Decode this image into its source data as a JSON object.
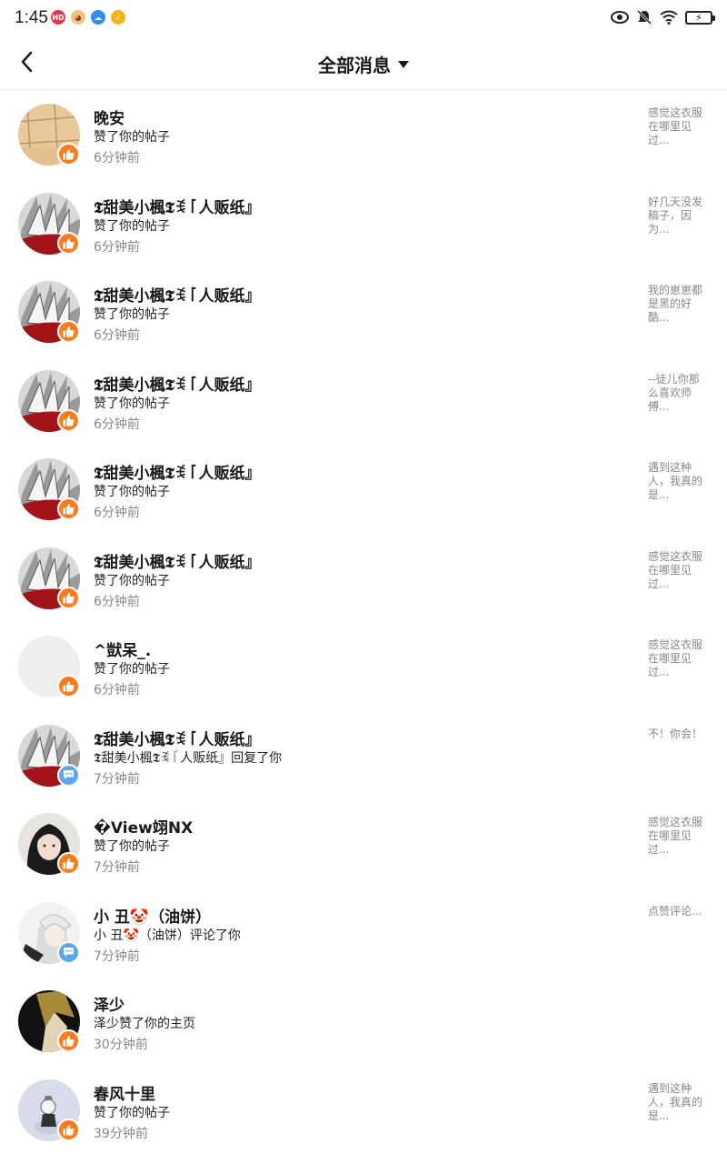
{
  "status_bar": {
    "time": "1:45",
    "app_icons": [
      "hdr-badge-icon",
      "monkey-app-icon",
      "cloud-app-icon",
      "shield-app-icon"
    ],
    "right_icons": [
      "eye-icon",
      "mute-bell-icon",
      "wifi-icon",
      "battery-charging-icon"
    ]
  },
  "header": {
    "title": "全部消息",
    "back_icon": "chevron-left-icon",
    "dropdown_icon": "caret-down-icon"
  },
  "colors": {
    "like_badge": "#ff7a1a",
    "comment_badge": "#5aa6f0",
    "secondary_text": "#888888"
  },
  "messages": [
    {
      "name": "晚安",
      "action": "赞了你的帖子",
      "time": "6分钟前",
      "preview": "感觉这衣服在哪里见过...",
      "badge": "like",
      "avatar": "paper-avatar"
    },
    {
      "name": "𝕿甜美小楓𝕿ꉂ『人贩纸』",
      "action": "赞了你的帖子",
      "time": "6分钟前",
      "preview": "好几天没发稿子，因为...",
      "badge": "like",
      "avatar": "armor-avatar"
    },
    {
      "name": "𝕿甜美小楓𝕿ꉂ『人贩纸』",
      "action": "赞了你的帖子",
      "time": "6分钟前",
      "preview": "我的崽崽都是黑的好酷...",
      "badge": "like",
      "avatar": "armor-avatar"
    },
    {
      "name": "𝕿甜美小楓𝕿ꉂ『人贩纸』",
      "action": "赞了你的帖子",
      "time": "6分钟前",
      "preview": "--徒儿你那么喜欢师傅...",
      "badge": "like",
      "avatar": "armor-avatar"
    },
    {
      "name": "𝕿甜美小楓𝕿ꉂ『人贩纸』",
      "action": "赞了你的帖子",
      "time": "6分钟前",
      "preview": "遇到这种人，我真的是...",
      "badge": "like",
      "avatar": "armor-avatar"
    },
    {
      "name": "𝕿甜美小楓𝕿ꉂ『人贩纸』",
      "action": "赞了你的帖子",
      "time": "6分钟前",
      "preview": "感觉这衣服在哪里见过...",
      "badge": "like",
      "avatar": "armor-avatar"
    },
    {
      "name": "^獃呆_.",
      "action": "赞了你的帖子",
      "time": "6分钟前",
      "preview": "感觉这衣服在哪里见过...",
      "badge": "like",
      "avatar": "blank-avatar"
    },
    {
      "name": "𝕿甜美小楓𝕿ꉂ『人贩纸』",
      "action": "𝕿甜美小楓𝕿ꉂ『人贩纸』回复了你",
      "time": "7分钟前",
      "preview": "不！你会！",
      "badge": "comment",
      "avatar": "armor-avatar"
    },
    {
      "name": "�View翊NX",
      "action": "赞了你的帖子",
      "time": "7分钟前",
      "preview": "感觉这衣服在哪里见过...",
      "badge": "like",
      "avatar": "girl-avatar"
    },
    {
      "name": "小 丑🤡（油饼）",
      "action": "小 丑🤡（油饼）评论了你",
      "time": "7分钟前",
      "preview": "点赞评论...",
      "badge": "comment",
      "avatar": "anime-avatar"
    },
    {
      "name": "泽少",
      "action": "泽少赞了你的主页",
      "time": "30分钟前",
      "preview": "",
      "badge": "like",
      "avatar": "dark-avatar"
    },
    {
      "name": "春风十里",
      "action": "赞了你的帖子",
      "time": "39分钟前",
      "preview": "遇到这种人，我真的是...",
      "badge": "like",
      "avatar": "chibi-avatar"
    }
  ]
}
